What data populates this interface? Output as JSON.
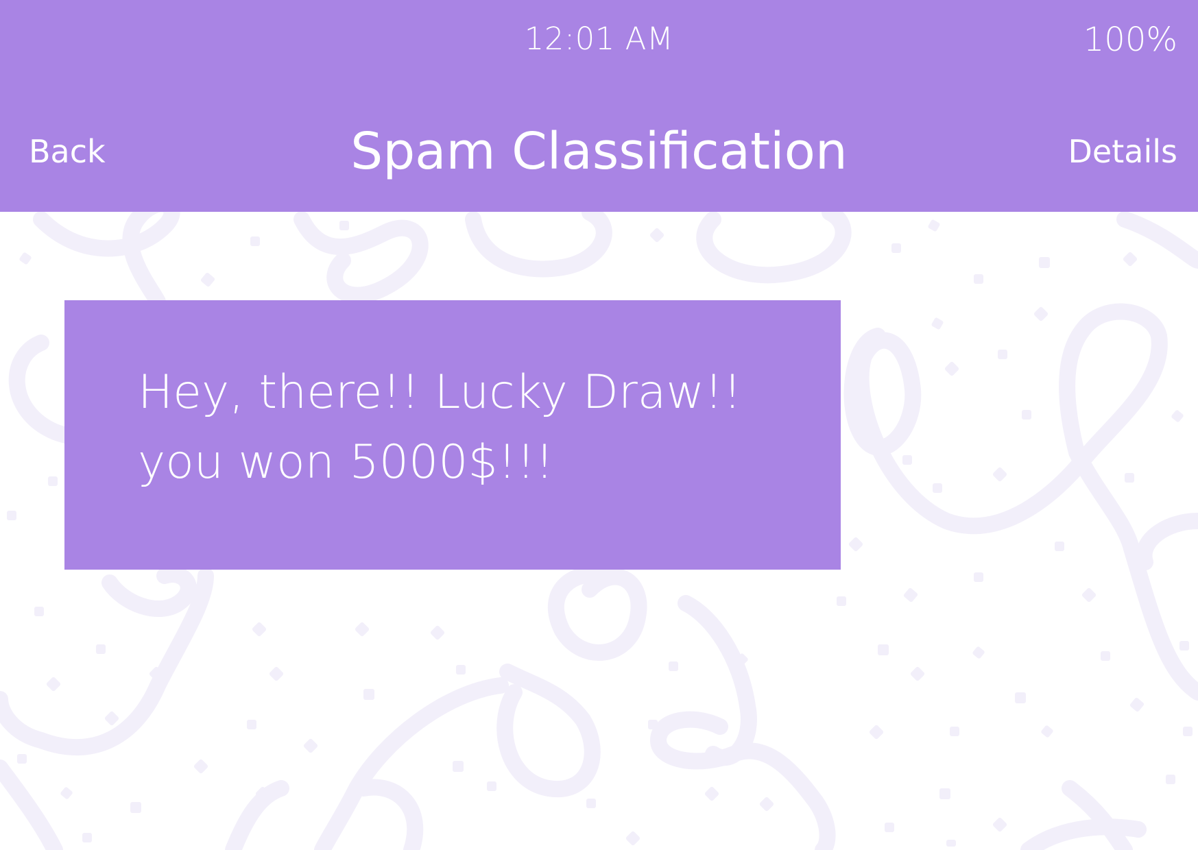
{
  "status_bar": {
    "time": "12:01 AM",
    "battery": "100%"
  },
  "nav": {
    "back_label": "Back",
    "title": "Spam Classification",
    "details_label": "Details"
  },
  "message": {
    "lines": [
      "Hey, there!! Lucky Draw!!",
      "you won 5000$!!!"
    ]
  },
  "colors": {
    "accent": "#a984e4",
    "background": "#ffffff",
    "pattern": "#f2effa"
  }
}
